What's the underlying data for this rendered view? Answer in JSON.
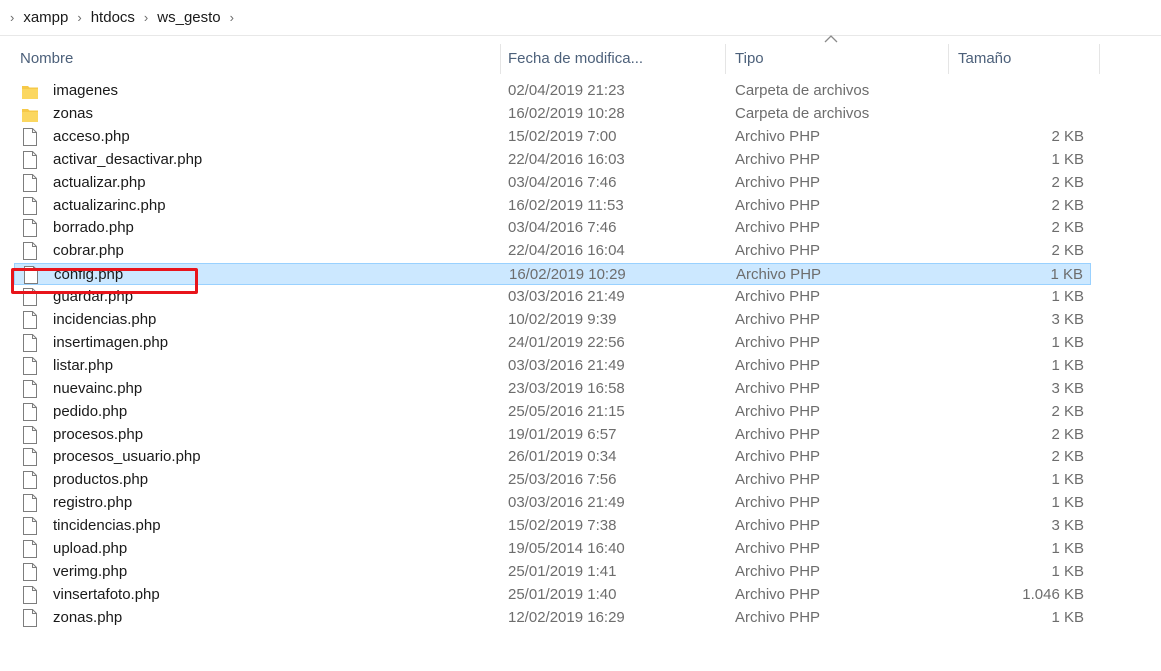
{
  "breadcrumb": [
    "xampp",
    "htdocs",
    "ws_gesto"
  ],
  "icons": {
    "breadcrumb_separator": "chevron-right-icon",
    "folder": "folder-icon",
    "file": "file-icon",
    "sort": "sort-ascending-icon"
  },
  "columns": {
    "name": "Nombre",
    "date": "Fecha de modifica...",
    "type": "Tipo",
    "size": "Tamaño"
  },
  "colors": {
    "folder": "#f6c948",
    "selected_background": "#cce8ff",
    "selected_border": "#99d1ff",
    "highlight": "#e8141b"
  },
  "files": [
    {
      "name": "imagenes",
      "date": "02/04/2019 21:23",
      "type": "Carpeta de archivos",
      "size": "",
      "kind": "folder"
    },
    {
      "name": "zonas",
      "date": "16/02/2019 10:28",
      "type": "Carpeta de archivos",
      "size": "",
      "kind": "folder"
    },
    {
      "name": "acceso.php",
      "date": "15/02/2019 7:00",
      "type": "Archivo PHP",
      "size": "2 KB",
      "kind": "file"
    },
    {
      "name": "activar_desactivar.php",
      "date": "22/04/2016 16:03",
      "type": "Archivo PHP",
      "size": "1 KB",
      "kind": "file"
    },
    {
      "name": "actualizar.php",
      "date": "03/04/2016 7:46",
      "type": "Archivo PHP",
      "size": "2 KB",
      "kind": "file"
    },
    {
      "name": "actualizarinc.php",
      "date": "16/02/2019 11:53",
      "type": "Archivo PHP",
      "size": "2 KB",
      "kind": "file"
    },
    {
      "name": "borrado.php",
      "date": "03/04/2016 7:46",
      "type": "Archivo PHP",
      "size": "2 KB",
      "kind": "file"
    },
    {
      "name": "cobrar.php",
      "date": "22/04/2016 16:04",
      "type": "Archivo PHP",
      "size": "2 KB",
      "kind": "file"
    },
    {
      "name": "config.php",
      "date": "16/02/2019 10:29",
      "type": "Archivo PHP",
      "size": "1 KB",
      "kind": "file",
      "selected": true
    },
    {
      "name": "guardar.php",
      "date": "03/03/2016 21:49",
      "type": "Archivo PHP",
      "size": "1 KB",
      "kind": "file"
    },
    {
      "name": "incidencias.php",
      "date": "10/02/2019 9:39",
      "type": "Archivo PHP",
      "size": "3 KB",
      "kind": "file"
    },
    {
      "name": "insertimagen.php",
      "date": "24/01/2019 22:56",
      "type": "Archivo PHP",
      "size": "1 KB",
      "kind": "file"
    },
    {
      "name": "listar.php",
      "date": "03/03/2016 21:49",
      "type": "Archivo PHP",
      "size": "1 KB",
      "kind": "file"
    },
    {
      "name": "nuevainc.php",
      "date": "23/03/2019 16:58",
      "type": "Archivo PHP",
      "size": "3 KB",
      "kind": "file"
    },
    {
      "name": "pedido.php",
      "date": "25/05/2016 21:15",
      "type": "Archivo PHP",
      "size": "2 KB",
      "kind": "file"
    },
    {
      "name": "procesos.php",
      "date": "19/01/2019 6:57",
      "type": "Archivo PHP",
      "size": "2 KB",
      "kind": "file"
    },
    {
      "name": "procesos_usuario.php",
      "date": "26/01/2019 0:34",
      "type": "Archivo PHP",
      "size": "2 KB",
      "kind": "file"
    },
    {
      "name": "productos.php",
      "date": "25/03/2016 7:56",
      "type": "Archivo PHP",
      "size": "1 KB",
      "kind": "file"
    },
    {
      "name": "registro.php",
      "date": "03/03/2016 21:49",
      "type": "Archivo PHP",
      "size": "1 KB",
      "kind": "file"
    },
    {
      "name": "tincidencias.php",
      "date": "15/02/2019 7:38",
      "type": "Archivo PHP",
      "size": "3 KB",
      "kind": "file"
    },
    {
      "name": "upload.php",
      "date": "19/05/2014 16:40",
      "type": "Archivo PHP",
      "size": "1 KB",
      "kind": "file"
    },
    {
      "name": "verimg.php",
      "date": "25/01/2019 1:41",
      "type": "Archivo PHP",
      "size": "1 KB",
      "kind": "file"
    },
    {
      "name": "vinsertafoto.php",
      "date": "25/01/2019 1:40",
      "type": "Archivo PHP",
      "size": "1.046 KB",
      "kind": "file"
    },
    {
      "name": "zonas.php",
      "date": "12/02/2019 16:29",
      "type": "Archivo PHP",
      "size": "1 KB",
      "kind": "file"
    }
  ]
}
